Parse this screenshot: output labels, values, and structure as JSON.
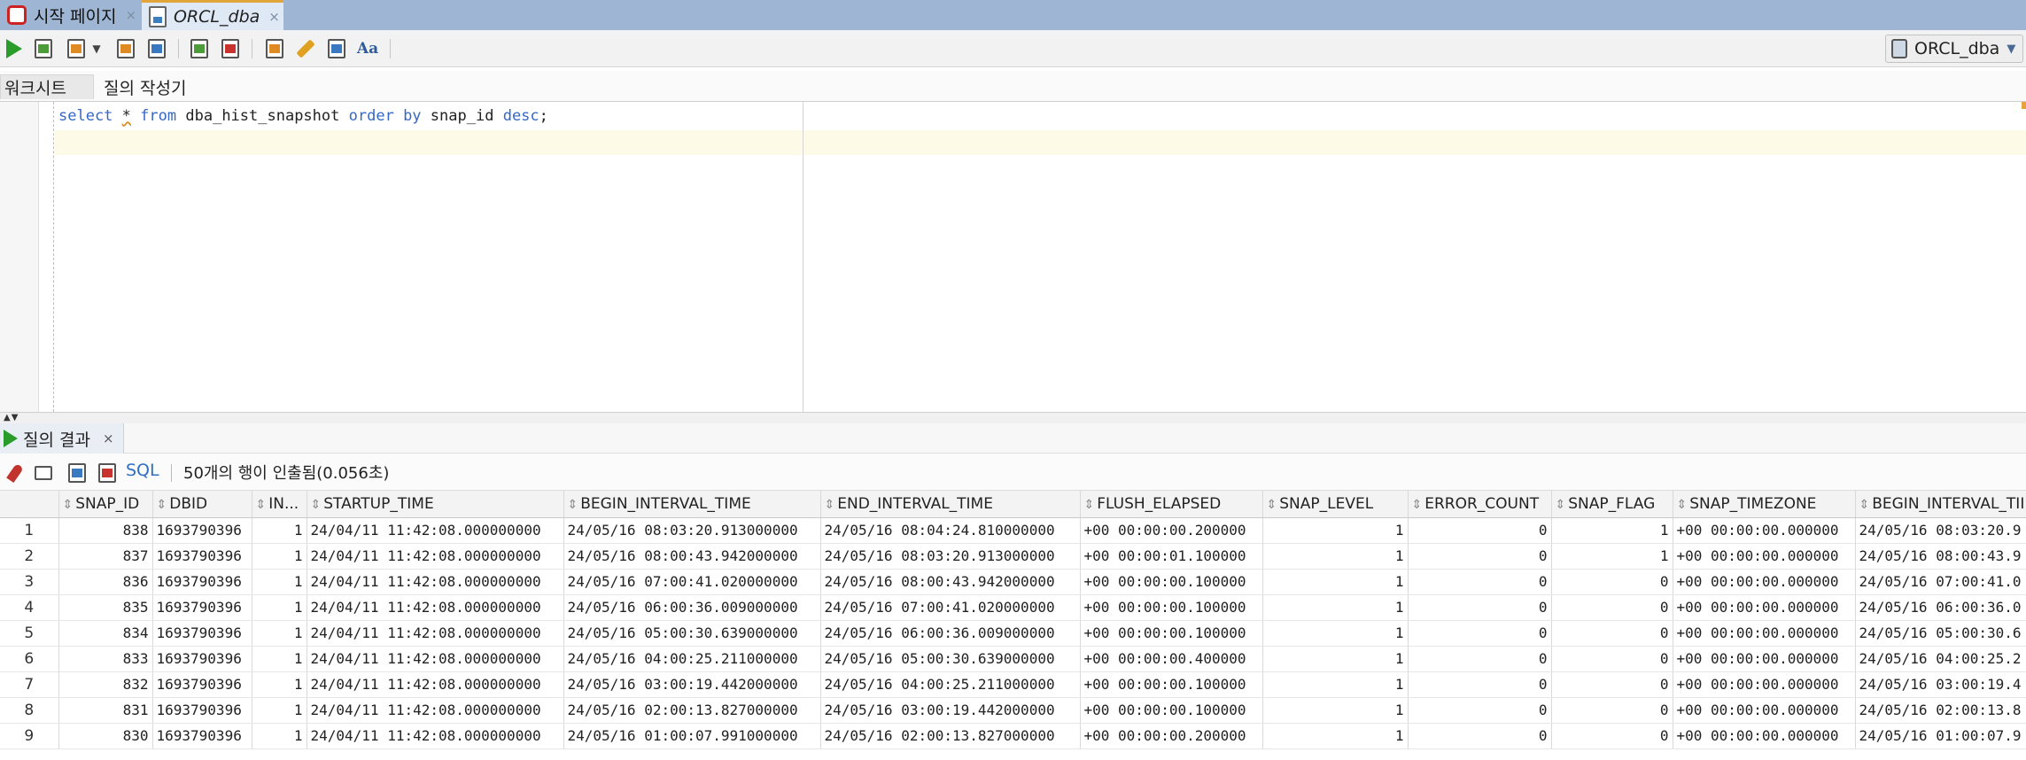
{
  "tabs": [
    {
      "label": "시작 페이지",
      "close": "×"
    },
    {
      "label": "ORCL_dba",
      "close": "×"
    }
  ],
  "toolbar": {
    "icons": [
      "run-statement-icon",
      "run-script-icon",
      "autotrace-icon",
      "dropdown-caret-icon",
      "explain-plan-icon",
      "sql-tuning-icon",
      "commit-icon",
      "rollback-icon",
      "sql-format-icon",
      "clear-icon",
      "history-icon",
      "to-upper-icon"
    ],
    "connection": "ORCL_dba"
  },
  "subtabs": {
    "worksheet": "워크시트",
    "query_builder": "질의 작성기"
  },
  "editor": {
    "tokens": [
      "select",
      "*",
      "from",
      "dba_hist_snapshot",
      "order",
      "by",
      "snap_id",
      "desc",
      ";"
    ]
  },
  "result": {
    "tab_label": "질의 결과",
    "tab_close": "×",
    "sql_label": "SQL",
    "status": "50개의 행이 인출됨(0.056초)"
  },
  "grid": {
    "columns": [
      "SNAP_ID",
      "DBID",
      "IN...",
      "STARTUP_TIME",
      "BEGIN_INTERVAL_TIME",
      "END_INTERVAL_TIME",
      "FLUSH_ELAPSED",
      "SNAP_LEVEL",
      "ERROR_COUNT",
      "SNAP_FLAG",
      "SNAP_TIMEZONE",
      "BEGIN_INTERVAL_TII"
    ],
    "rows": [
      [
        "1",
        "838",
        "1693790396",
        "1",
        "24/04/11 11:42:08.000000000",
        "24/05/16 08:03:20.913000000",
        "24/05/16 08:04:24.810000000",
        "+00 00:00:00.200000",
        "1",
        "0",
        "1",
        "+00 00:00:00.000000",
        "24/05/16 08:03:20.9"
      ],
      [
        "2",
        "837",
        "1693790396",
        "1",
        "24/04/11 11:42:08.000000000",
        "24/05/16 08:00:43.942000000",
        "24/05/16 08:03:20.913000000",
        "+00 00:00:01.100000",
        "1",
        "0",
        "1",
        "+00 00:00:00.000000",
        "24/05/16 08:00:43.9"
      ],
      [
        "3",
        "836",
        "1693790396",
        "1",
        "24/04/11 11:42:08.000000000",
        "24/05/16 07:00:41.020000000",
        "24/05/16 08:00:43.942000000",
        "+00 00:00:00.100000",
        "1",
        "0",
        "0",
        "+00 00:00:00.000000",
        "24/05/16 07:00:41.0"
      ],
      [
        "4",
        "835",
        "1693790396",
        "1",
        "24/04/11 11:42:08.000000000",
        "24/05/16 06:00:36.009000000",
        "24/05/16 07:00:41.020000000",
        "+00 00:00:00.100000",
        "1",
        "0",
        "0",
        "+00 00:00:00.000000",
        "24/05/16 06:00:36.0"
      ],
      [
        "5",
        "834",
        "1693790396",
        "1",
        "24/04/11 11:42:08.000000000",
        "24/05/16 05:00:30.639000000",
        "24/05/16 06:00:36.009000000",
        "+00 00:00:00.100000",
        "1",
        "0",
        "0",
        "+00 00:00:00.000000",
        "24/05/16 05:00:30.6"
      ],
      [
        "6",
        "833",
        "1693790396",
        "1",
        "24/04/11 11:42:08.000000000",
        "24/05/16 04:00:25.211000000",
        "24/05/16 05:00:30.639000000",
        "+00 00:00:00.400000",
        "1",
        "0",
        "0",
        "+00 00:00:00.000000",
        "24/05/16 04:00:25.2"
      ],
      [
        "7",
        "832",
        "1693790396",
        "1",
        "24/04/11 11:42:08.000000000",
        "24/05/16 03:00:19.442000000",
        "24/05/16 04:00:25.211000000",
        "+00 00:00:00.100000",
        "1",
        "0",
        "0",
        "+00 00:00:00.000000",
        "24/05/16 03:00:19.4"
      ],
      [
        "8",
        "831",
        "1693790396",
        "1",
        "24/04/11 11:42:08.000000000",
        "24/05/16 02:00:13.827000000",
        "24/05/16 03:00:19.442000000",
        "+00 00:00:00.100000",
        "1",
        "0",
        "0",
        "+00 00:00:00.000000",
        "24/05/16 02:00:13.8"
      ],
      [
        "9",
        "830",
        "1693790396",
        "1",
        "24/04/11 11:42:08.000000000",
        "24/05/16 01:00:07.991000000",
        "24/05/16 02:00:13.827000000",
        "+00 00:00:00.200000",
        "1",
        "0",
        "0",
        "+00 00:00:00.000000",
        "24/05/16 01:00:07.9"
      ]
    ]
  },
  "colors": {
    "tabstrip": "#9eb6d4",
    "keyword": "#3568c6",
    "run_green": "#2a9c2a",
    "active_tab_accent": "#e1a53a"
  }
}
